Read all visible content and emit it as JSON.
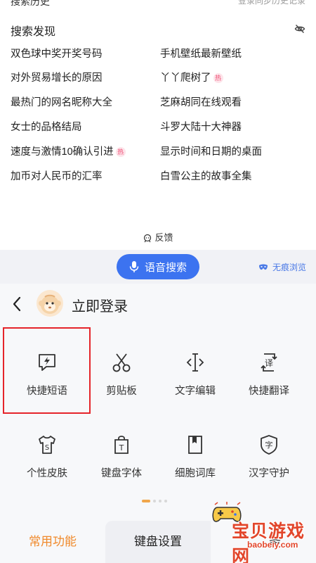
{
  "history": {
    "title_cut": "搜索历史",
    "sync_cut": "登录同步历史记录"
  },
  "discovery": {
    "title": "搜索发现",
    "hide_icon": "eye-off-icon",
    "left": [
      {
        "text": "双色球中奖开奖号码",
        "hot": false
      },
      {
        "text": "对外贸易增长的原因",
        "hot": false
      },
      {
        "text": "最热门的网名昵称大全",
        "hot": false
      },
      {
        "text": "女士的品格结局",
        "hot": false
      },
      {
        "text": "速度与激情10确认引进",
        "hot": true
      },
      {
        "text": "加币对人民币的汇率",
        "hot": false
      }
    ],
    "right": [
      {
        "text": "手机壁纸最新壁纸",
        "hot": false
      },
      {
        "text": "丫丫爬树了",
        "hot": true
      },
      {
        "text": "芝麻胡同在线观看",
        "hot": false
      },
      {
        "text": "斗罗大陆十大神器",
        "hot": false
      },
      {
        "text": "显示时间和日期的桌面",
        "hot": false
      },
      {
        "text": "白雪公主的故事全集",
        "hot": false
      }
    ],
    "hot_label": "热",
    "feedback": "反馈"
  },
  "toolbar": {
    "voice_label": "语音搜索",
    "incognito_label": "无痕浏览"
  },
  "panel": {
    "login_label": "立即登录",
    "items": [
      {
        "label": "快捷短语",
        "icon": "quick-phrase-icon"
      },
      {
        "label": "剪贴板",
        "icon": "scissors-icon"
      },
      {
        "label": "文字编辑",
        "icon": "text-cursor-icon"
      },
      {
        "label": "快捷翻译",
        "icon": "translate-icon"
      },
      {
        "label": "个性皮肤",
        "icon": "tshirt-icon"
      },
      {
        "label": "键盘字体",
        "icon": "font-bag-icon"
      },
      {
        "label": "细胞词库",
        "icon": "book-icon"
      },
      {
        "label": "汉字守护",
        "icon": "hanzi-guard-icon"
      }
    ],
    "page_indicator": {
      "current": 1,
      "total": 4
    }
  },
  "tabs": {
    "common": "常用功能",
    "keyboard": "键盘设置",
    "more_cut": "务"
  },
  "watermark": {
    "text": "宝贝游戏网",
    "url": "baobeiy.com"
  },
  "colors": {
    "accent_blue": "#3c73f0",
    "accent_orange": "#f08a2c",
    "highlight_red": "#e5242a",
    "hot_pink": "#ef4f75"
  }
}
